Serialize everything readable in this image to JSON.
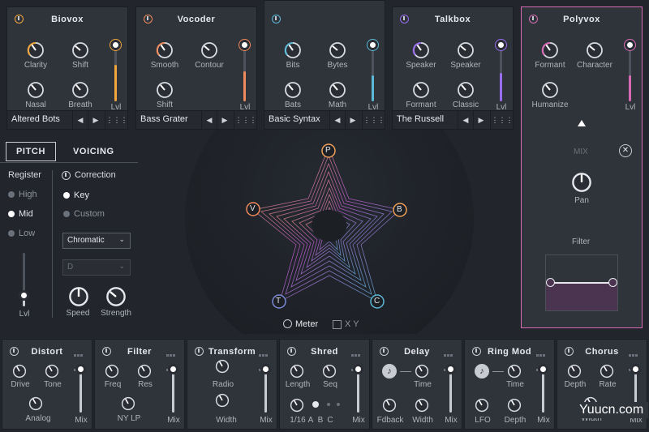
{
  "vocals": [
    {
      "title": "Biovox",
      "accent": "#f0a63c",
      "knobs": [
        "Clarity",
        "Shift",
        "Nasal",
        "Breath"
      ],
      "lvl": "Lvl",
      "preset": "Altered Bots",
      "level": 0.62
    },
    {
      "title": "Vocoder",
      "accent": "#f08a5c",
      "knobs": [
        "Smooth",
        "Contour",
        "Shift"
      ],
      "lvl": "Lvl",
      "preset": "Bass Grater",
      "level": 0.52
    },
    {
      "title": "",
      "accent": "#5bb8d6",
      "knobs": [
        "Bits",
        "Bytes",
        "Bats",
        "Math"
      ],
      "lvl": "Lvl",
      "preset": "Basic Syntax",
      "level": 0.45
    },
    {
      "title": "Talkbox",
      "accent": "#9a6cf0",
      "knobs": [
        "Speaker",
        "Speaker",
        "Formant",
        "Classic"
      ],
      "lvl": "Lvl",
      "preset": "The Russell",
      "level": 0.48
    },
    {
      "title": "Polyvox",
      "accent": "#d86ab4",
      "knobs": [
        "Formant",
        "Character",
        "Humanize"
      ],
      "lvl": "Lvl",
      "preset": "",
      "level": 0.45
    }
  ],
  "pitch": {
    "tabs": [
      "PITCH",
      "VOICING"
    ],
    "register_label": "Register",
    "registers": [
      "High",
      "Mid",
      "Low"
    ],
    "correction_label": "Correction",
    "correction_modes": [
      "Key",
      "Custom"
    ],
    "scale": "Chromatic",
    "key": "D",
    "knobs": [
      "Speed",
      "Strength"
    ],
    "lvl": "Lvl"
  },
  "center": {
    "nodes": [
      "P",
      "B",
      "C",
      "T",
      "V"
    ],
    "meter_label": "Meter",
    "xy_label": "X Y"
  },
  "side": {
    "mix_label": "MIX",
    "pan_label": "Pan",
    "filter_label": "Filter"
  },
  "modules": [
    {
      "title": "Distort",
      "labels": [
        "Drive",
        "Tone",
        "Analog",
        "Mix"
      ]
    },
    {
      "title": "Filter",
      "labels": [
        "Freq",
        "Res",
        "NY LP",
        "Mix"
      ]
    },
    {
      "title": "Transform",
      "labels": [
        "Radio",
        "Width",
        "Mix"
      ]
    },
    {
      "title": "Shred",
      "labels": [
        "Length",
        "Seq",
        "1/16",
        "A",
        "B",
        "C",
        "Mix"
      ]
    },
    {
      "title": "Delay",
      "labels": [
        "Time",
        "Fdback",
        "Width",
        "Mix"
      ]
    },
    {
      "title": "Ring Mod",
      "labels": [
        "Time",
        "LFO",
        "Depth",
        "Mix"
      ]
    },
    {
      "title": "Chorus",
      "labels": [
        "Depth",
        "Rate",
        "Width",
        "Mix"
      ]
    }
  ],
  "watermark": "Yuucn.com"
}
